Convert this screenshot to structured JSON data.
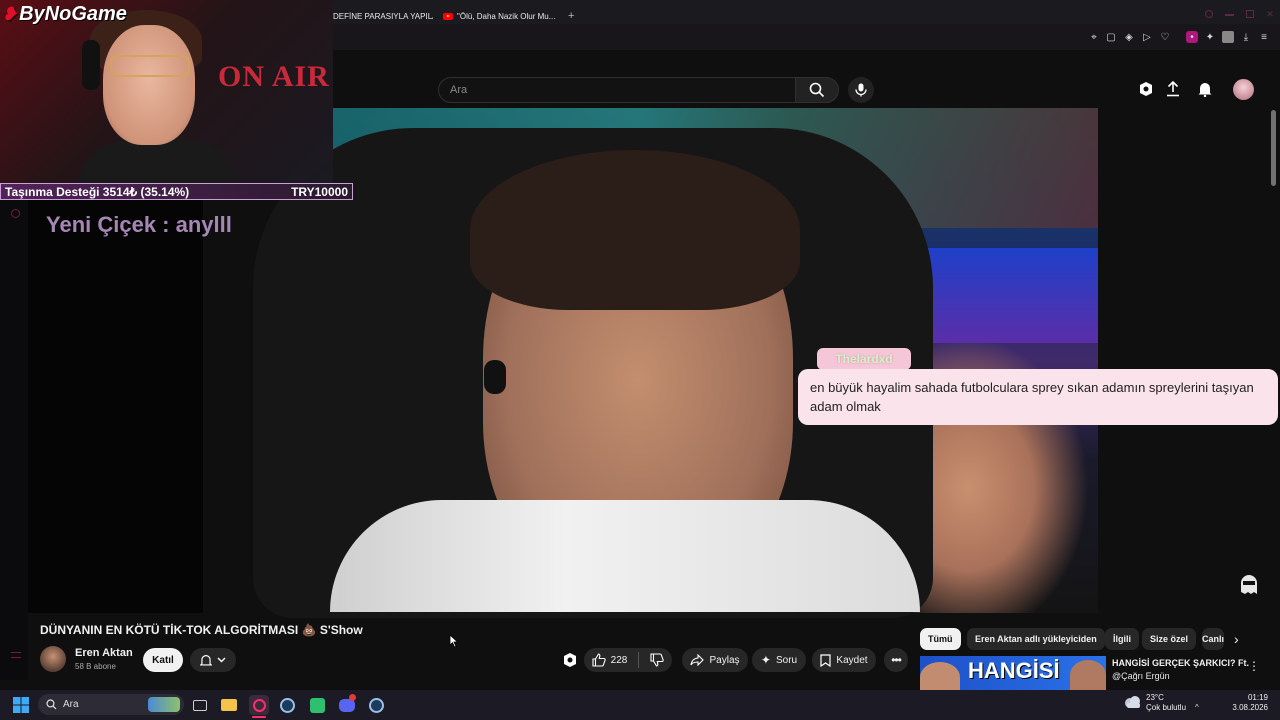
{
  "browser": {
    "tabs": [
      {
        "label": "DEFİNE PARASIYLA YAPILAN..."
      },
      {
        "label": "\"Ölü, Daha Nazik Olur Mu..."
      }
    ],
    "new_tab": "+"
  },
  "stream_overlay": {
    "logo": "ByNoGame",
    "donation_goal_text": "Taşınma Desteği 3514₺ (35.14%)",
    "donation_goal_target": "TRY10000",
    "donation_progress_percent": 35.14,
    "new_follower_text": "Yeni Çiçek : anylll",
    "sign_text": "ON AIR",
    "chat_username": "Thelardxd",
    "chat_message": "en büyük hayalim sahada futbolculara sprey sıkan adamın spreylerini taşıyan adam olmak"
  },
  "youtube": {
    "search_placeholder": "Ara",
    "video_title": "DÜNYANIN EN KÖTÜ TİK-TOK ALGORİTMASI 💩 S'Show",
    "channel_name": "Eren Aktan",
    "channel_subs": "58 B abone",
    "join_label": "Katıl",
    "like_count": "228",
    "share_label": "Paylaş",
    "ask_label": "Soru",
    "save_label": "Kaydet",
    "chips": [
      "Tümü",
      "Eren Aktan adlı yükleyiciden",
      "İlgili",
      "Size özel",
      "Canlı"
    ],
    "recommendation": {
      "thumb_text": "HANGİSİ",
      "title": "HANGİSİ GERÇEK ŞARKICI? Ft.",
      "channel": "@Çağrı Ergün"
    }
  },
  "taskbar": {
    "search_label": "Ara",
    "weather_temp": "23°C",
    "weather_desc": "Çok bulutlu",
    "time": "01:19",
    "date": "3.08.2026"
  },
  "colors": {
    "youtube_bg": "#0f0f0f",
    "chat_bubble": "#fbe3ec",
    "donation_bar": "#53235a",
    "yt_red": "#ff0000"
  }
}
